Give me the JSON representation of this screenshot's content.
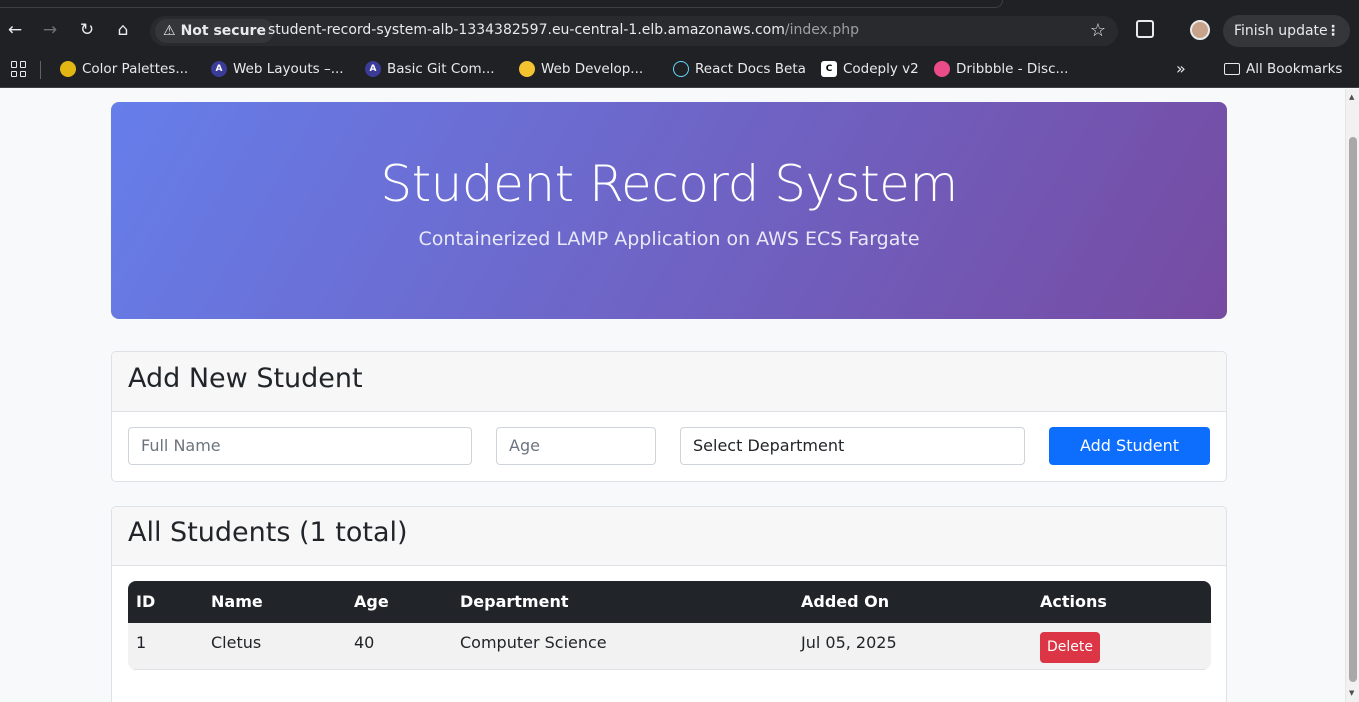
{
  "browser": {
    "security_label": "Not secure",
    "url_host": "student-record-system-alb-1334382597.eu-central-1.elb.amazonaws.com",
    "url_path": "/index.php",
    "update_label": "Finish update"
  },
  "bookmarks": {
    "items": [
      {
        "label": "Color Palettes...",
        "color": "#e2b714"
      },
      {
        "label": "Web Layouts –...",
        "color": "#3b3b98"
      },
      {
        "label": "Basic Git Com...",
        "color": "#3b3b98"
      },
      {
        "label": "Web Develop...",
        "color": "#f4c430"
      },
      {
        "label": "React Docs Beta",
        "color": "#61dafb"
      },
      {
        "label": "Codeply v2",
        "color": "#ffffff"
      },
      {
        "label": "Dribbble - Disc...",
        "color": "#ea4c89"
      }
    ],
    "all_label": "All Bookmarks"
  },
  "hero": {
    "title": "Student Record System",
    "subtitle": "Containerized LAMP Application on AWS ECS Fargate"
  },
  "form": {
    "title": "Add New Student",
    "name_placeholder": "Full Name",
    "age_placeholder": "Age",
    "department_selected": "Select Department",
    "submit_label": "Add Student"
  },
  "students": {
    "title": "All Students (1 total)",
    "columns": [
      "ID",
      "Name",
      "Age",
      "Department",
      "Added On",
      "Actions"
    ],
    "rows": [
      {
        "id": "1",
        "name": "Cletus",
        "age": "40",
        "department": "Computer Science",
        "added_on": "Jul 05, 2025",
        "action": "Delete"
      }
    ]
  },
  "colors": {
    "hero_gradient_start": "#667eea",
    "hero_gradient_end": "#764ba2",
    "primary": "#0d6efd",
    "danger": "#dc3545",
    "table_header": "#212529"
  }
}
